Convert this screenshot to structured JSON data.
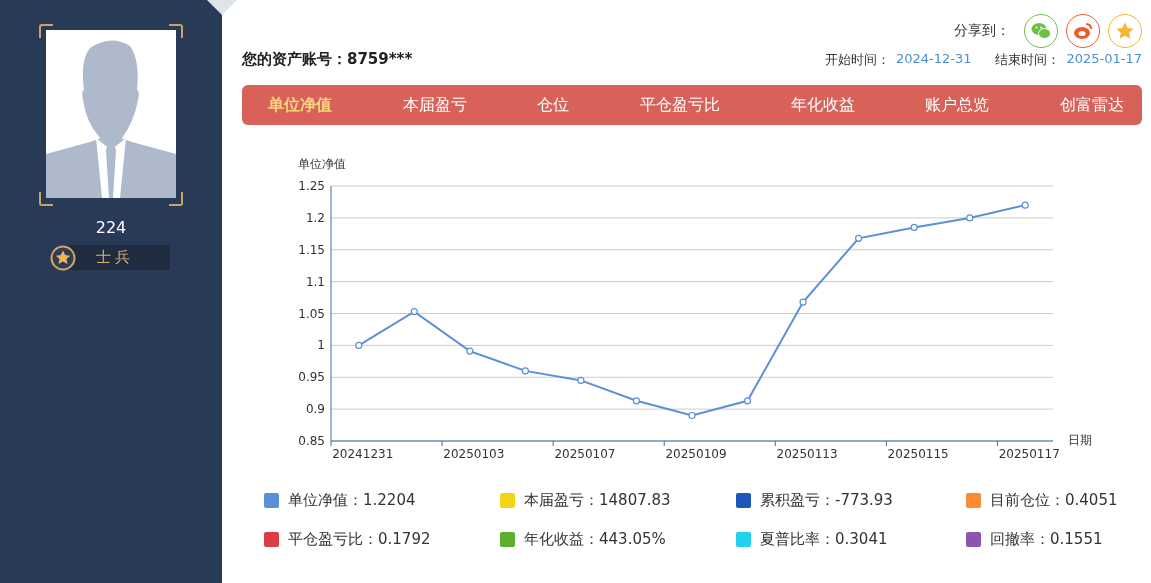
{
  "profile": {
    "score": "224",
    "rank": "士兵"
  },
  "share": {
    "label": "分享到："
  },
  "account": {
    "label": "您的资产账号：",
    "value": "8759***"
  },
  "period": {
    "start_label": "开始时间：",
    "start": "2024-12-31",
    "end_label": "结束时间：",
    "end": "2025-01-17"
  },
  "tabs": [
    {
      "label": "单位净值",
      "selected": true
    },
    {
      "label": "本届盈亏",
      "selected": false
    },
    {
      "label": "仓位",
      "selected": false
    },
    {
      "label": "平仓盈亏比",
      "selected": false
    },
    {
      "label": "年化收益",
      "selected": false
    },
    {
      "label": "账户总览",
      "selected": false
    },
    {
      "label": "创富雷达",
      "selected": false
    }
  ],
  "chart_data": {
    "type": "line",
    "ylabel": "单位净值",
    "xlabel": "日期",
    "ylim": [
      0.85,
      1.25
    ],
    "yticks": [
      0.85,
      0.9,
      0.95,
      1,
      1.05,
      1.1,
      1.15,
      1.2,
      1.25
    ],
    "grid": true,
    "categories": [
      "20241231",
      null,
      "20250103",
      null,
      "20250107",
      null,
      "20250109",
      null,
      "20250113",
      null,
      "20250115",
      null,
      "20250117"
    ],
    "series": [
      {
        "color": "#5b8fd9",
        "marker": "circle",
        "values": [
          1.0,
          1.053,
          0.991,
          0.96,
          0.945,
          0.913,
          0.89,
          0.913,
          1.068,
          1.168,
          1.185,
          1.2,
          1.22
        ]
      }
    ]
  },
  "stats": [
    {
      "label": "单位净值：",
      "value": "1.2204",
      "color": "#5b8fd9"
    },
    {
      "label": "本届盈亏：",
      "value": "14807.83",
      "color": "#f2d417"
    },
    {
      "label": "累积盈亏：",
      "value": "-773.93",
      "color": "#1d55b8"
    },
    {
      "label": "目前仓位：",
      "value": "0.4051",
      "color": "#f98c35"
    },
    {
      "label": "平仓盈亏比：",
      "value": "0.1792",
      "color": "#dc3d44"
    },
    {
      "label": "年化收益：",
      "value": "443.05%",
      "color": "#5dae2d"
    },
    {
      "label": "夏普比率：",
      "value": "0.3041",
      "color": "#22d0f0"
    },
    {
      "label": "回撤率：",
      "value": "0.1551",
      "color": "#8a55ad"
    }
  ]
}
